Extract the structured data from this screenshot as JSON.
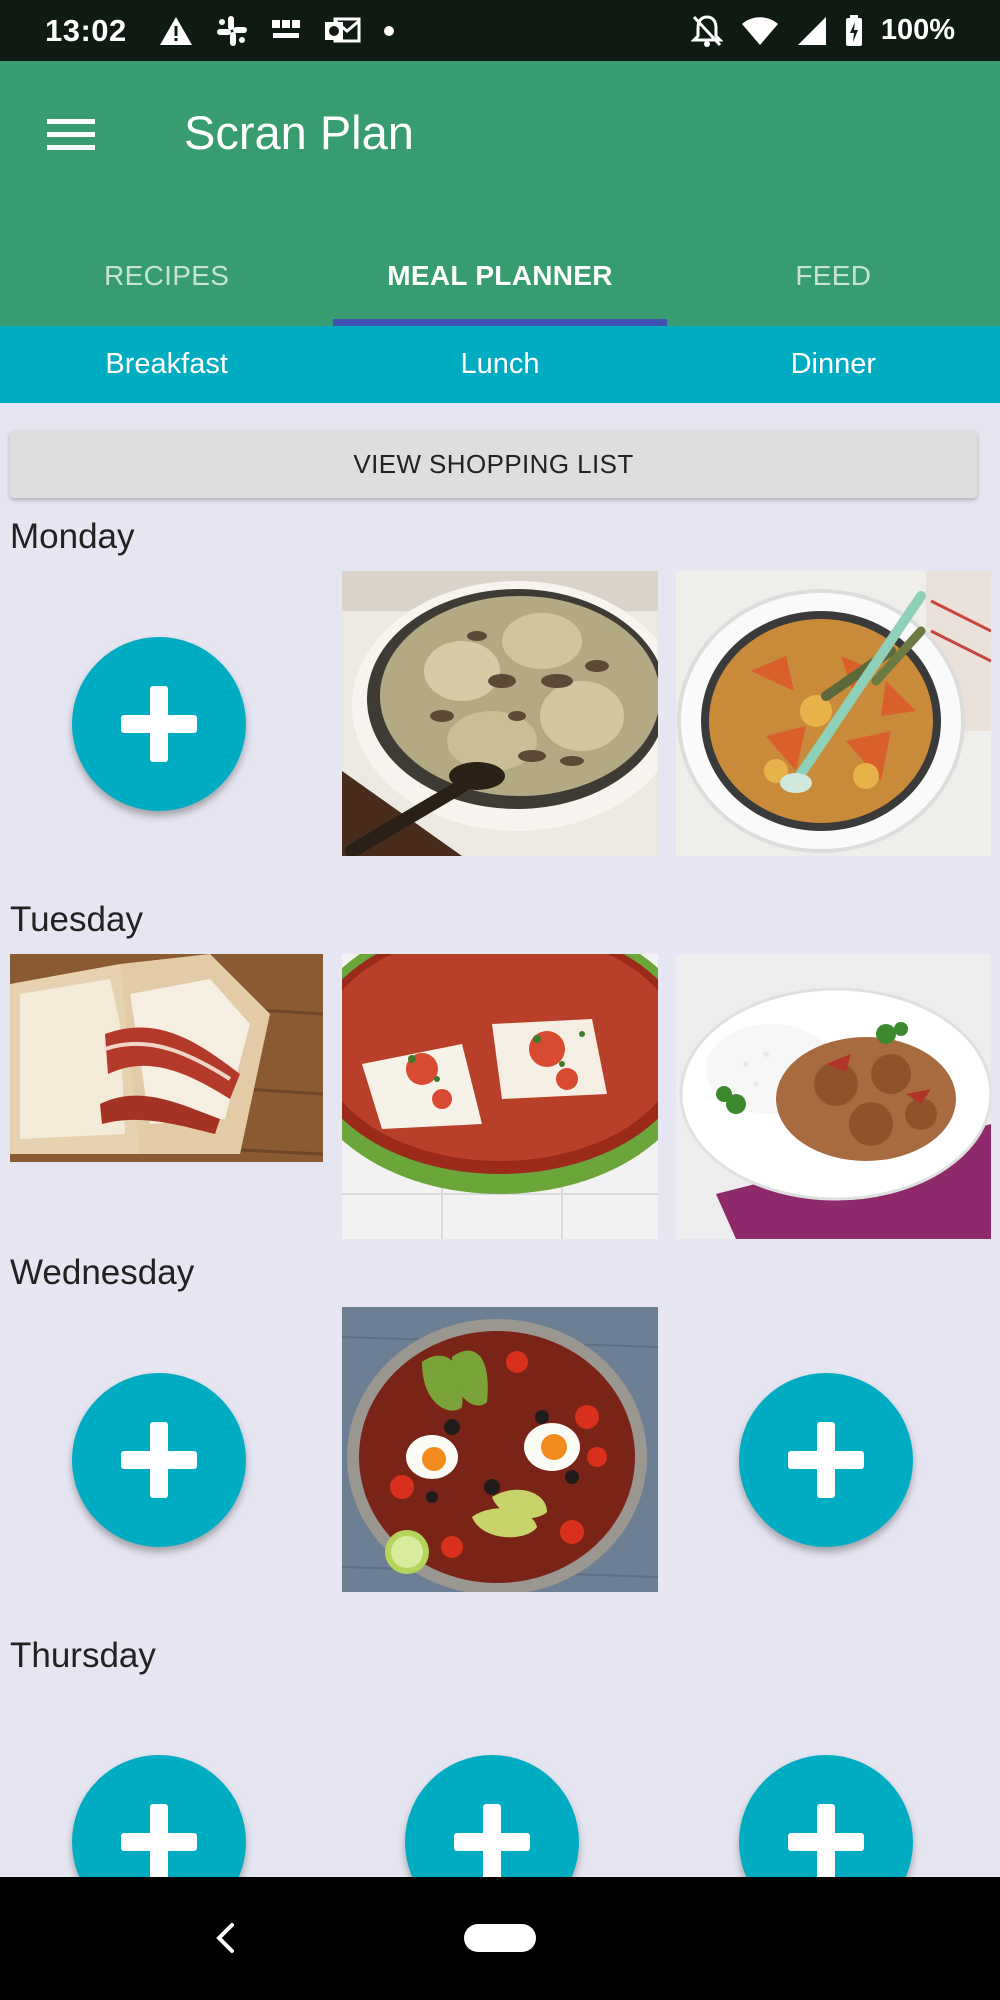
{
  "status_bar": {
    "time": "13:02",
    "battery": "100%",
    "left_icons": [
      "warning-icon",
      "slack-icon",
      "bbc-news-icon",
      "outlook-icon",
      "dot-icon"
    ],
    "right_icons": [
      "notifications-off-icon",
      "wifi-icon",
      "signal-icon",
      "battery-charging-icon"
    ]
  },
  "app_bar": {
    "title": "Scran Plan",
    "tabs": [
      {
        "label": "RECIPES",
        "active": false
      },
      {
        "label": "MEAL PLANNER",
        "active": true
      },
      {
        "label": "FEED",
        "active": false
      }
    ]
  },
  "meal_types": [
    "Breakfast",
    "Lunch",
    "Dinner"
  ],
  "shopping_list_button": "VIEW SHOPPING LIST",
  "days": [
    {
      "name": "Monday",
      "slots": [
        "add",
        "creamy-chicken-pan-image",
        "vegetable-stew-pot-image"
      ]
    },
    {
      "name": "Tuesday",
      "slots": [
        "bacon-sandwich-image",
        "fish-tomato-sauce-image",
        "chicken-curry-rice-image"
      ]
    },
    {
      "name": "Wednesday",
      "slots": [
        "add",
        "shakshuka-avocado-image",
        "add"
      ]
    },
    {
      "name": "Thursday",
      "slots": [
        "add",
        "add",
        "add"
      ]
    }
  ],
  "colors": {
    "app_bar": "#379c6f",
    "meal_bar": "#00acc1",
    "fab": "#00acc1",
    "tab_indicator": "#3f51b5",
    "background": "#e6e6f2"
  }
}
